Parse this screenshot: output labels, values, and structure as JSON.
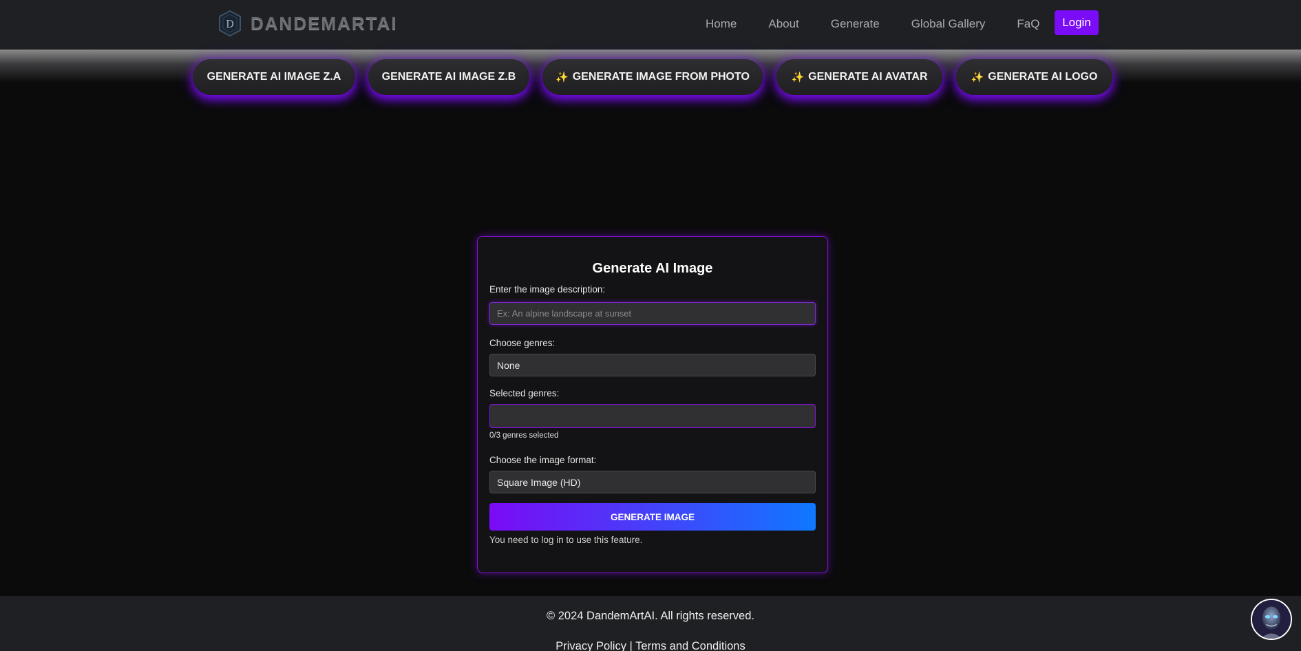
{
  "brand": {
    "name": "DANDEMARTAI",
    "badge_letter": "D"
  },
  "nav": {
    "items": [
      {
        "label": "Home"
      },
      {
        "label": "About"
      },
      {
        "label": "Generate"
      },
      {
        "label": "Global Gallery"
      },
      {
        "label": "FaQ"
      }
    ],
    "login_label": "Login"
  },
  "pills": [
    {
      "label": "GENERATE AI IMAGE Z.A",
      "sparkle": ""
    },
    {
      "label": "GENERATE AI IMAGE Z.B",
      "sparkle": ""
    },
    {
      "label": "GENERATE IMAGE FROM PHOTO",
      "sparkle": "✨"
    },
    {
      "label": "GENERATE AI AVATAR",
      "sparkle": "✨"
    },
    {
      "label": "GENERATE AI LOGO",
      "sparkle": "✨"
    }
  ],
  "form": {
    "title": "Generate AI Image",
    "description_label": "Enter the image description:",
    "description_placeholder": "Ex: An alpine landscape at sunset",
    "genres_label": "Choose genres:",
    "genres_value": "None",
    "selected_label": "Selected genres:",
    "selected_value": "",
    "selected_count": "0/3 genres selected",
    "format_label": "Choose the image format:",
    "format_value": "Square Image (HD)",
    "button_label": "GENERATE IMAGE",
    "note": "You need to log in to use this feature."
  },
  "footer": {
    "copyright": "© 2024 DandemArtAI. All rights reserved.",
    "privacy": "Privacy Policy",
    "separator": " | ",
    "terms": "Terms and Conditions"
  },
  "colors": {
    "accent": "#7b0cf7",
    "button_gradient_end": "#0f78ff",
    "glow": "#8a0fe6"
  }
}
